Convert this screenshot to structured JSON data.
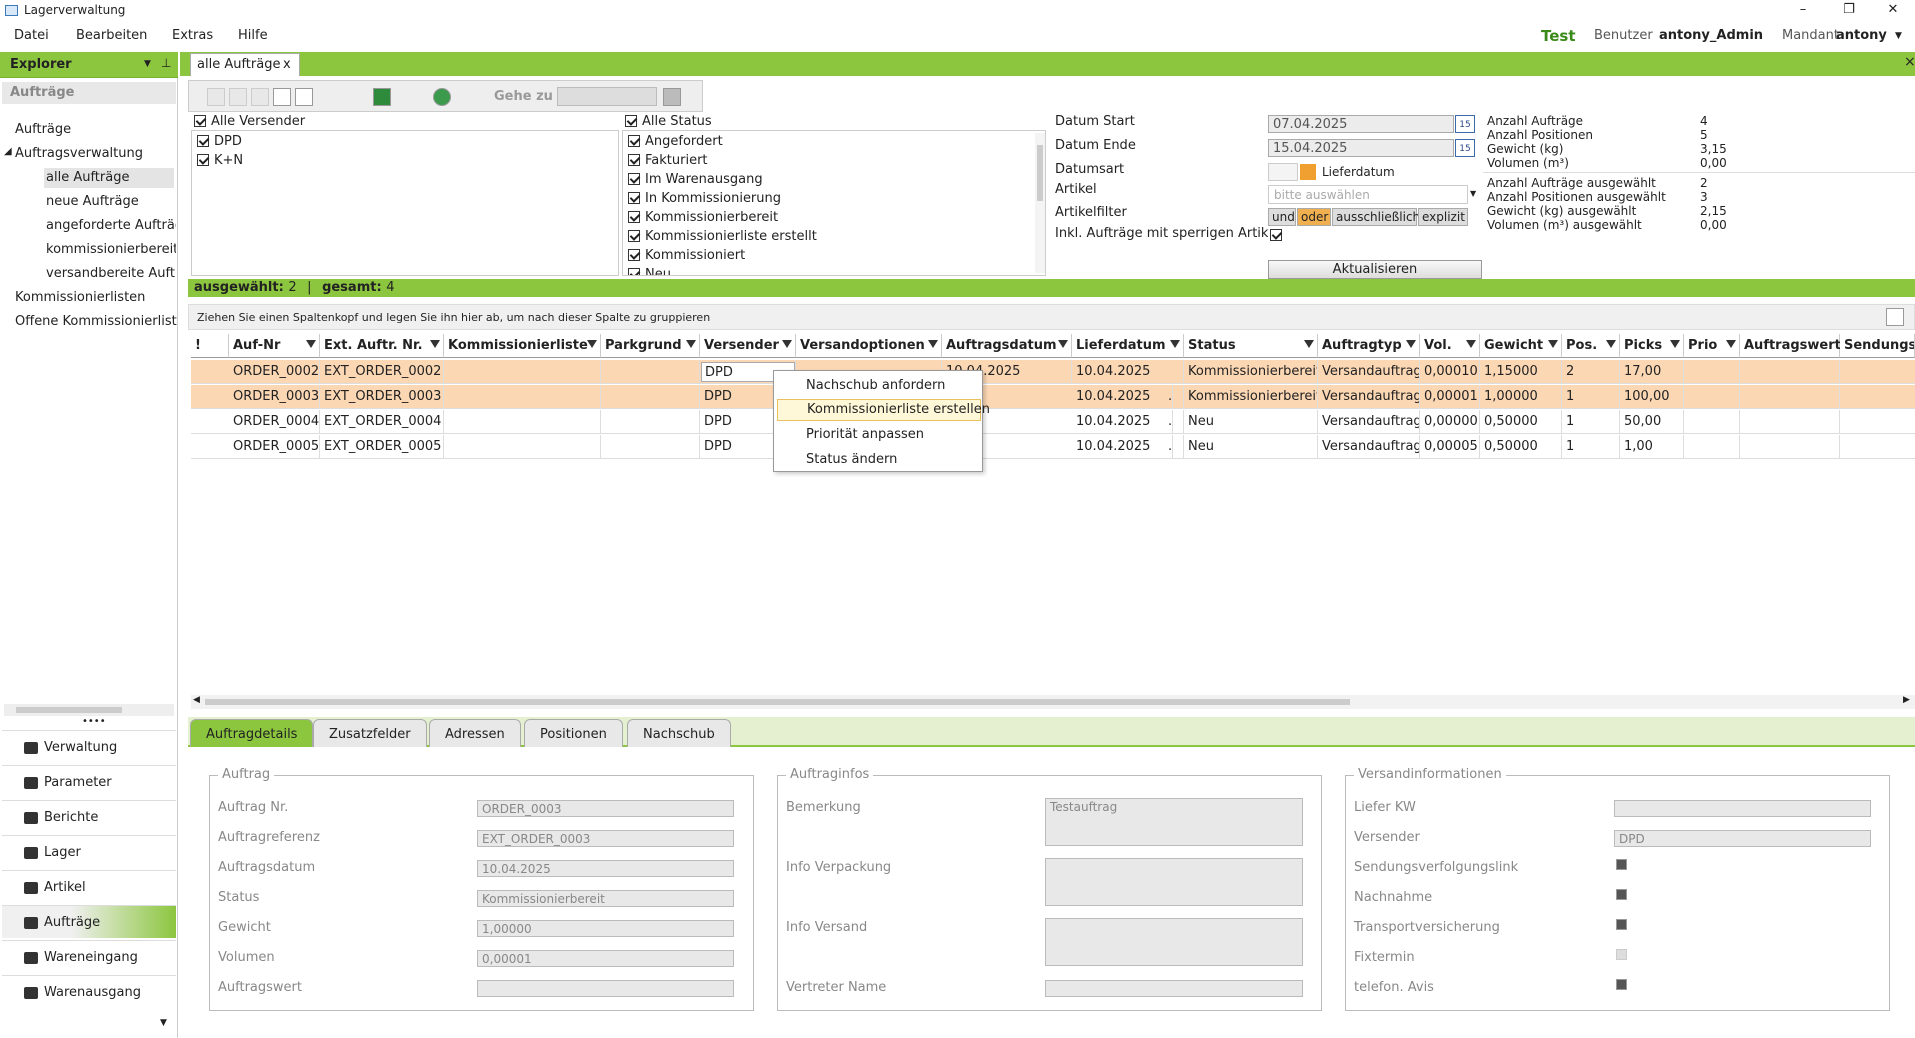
{
  "window": {
    "title": "Lagerverwaltung",
    "min": "–",
    "max": "❐",
    "close": "✕"
  },
  "menu": {
    "items": [
      "Datei",
      "Bearbeiten",
      "Extras",
      "Hilfe"
    ]
  },
  "env": {
    "name": "Test",
    "user_label": "Benutzer",
    "user": "antony_Admin",
    "mandant_label": "Mandant",
    "mandant": "antony"
  },
  "explorer": {
    "title": "Explorer",
    "section": "Aufträge",
    "tree": [
      "Aufträge",
      "Auftragsverwaltung",
      "alle Aufträge",
      "neue Aufträge",
      "angeforderte Aufträge",
      "kommissionierbereite",
      "versandbereite Aufträ",
      "Kommissionierlisten",
      "Offene Kommissionierlister"
    ],
    "nav": [
      "Verwaltung",
      "Parameter",
      "Berichte",
      "Lager",
      "Artikel",
      "Aufträge",
      "Wareneingang",
      "Warenausgang"
    ]
  },
  "tab": {
    "label": "alle Aufträge",
    "close": "x"
  },
  "toolbar": {
    "goto_label": "Gehe zu"
  },
  "filters": {
    "versender_all": "Alle Versender",
    "versender": [
      "DPD",
      "K+N"
    ],
    "status_all": "Alle Status",
    "status": [
      "Angefordert",
      "Fakturiert",
      "Im Warenausgang",
      "In Kommissionierung",
      "Kommissionierbereit",
      "Kommissionierliste erstellt",
      "Kommissioniert",
      "Neu"
    ],
    "datum_start_label": "Datum Start",
    "datum_start": "07.04.2025",
    "datum_ende_label": "Datum Ende",
    "datum_ende": "15.04.2025",
    "cal_label": "15",
    "datumsart_label": "Datumsart",
    "datumsart": "Lieferdatum",
    "artikel_label": "Artikel",
    "artikel_placeholder": "bitte auswählen",
    "artikelfilter_label": "Artikelfilter",
    "artikelfilter": [
      "und",
      "oder",
      "ausschließlich",
      "explizit"
    ],
    "sperrig_label": "Inkl. Aufträge mit sperrigen Artikeln",
    "refresh": "Aktualisieren"
  },
  "stats": [
    {
      "label": "Anzahl Aufträge",
      "value": "4"
    },
    {
      "label": "Anzahl Positionen",
      "value": "5"
    },
    {
      "label": "Gewicht (kg)",
      "value": "3,15"
    },
    {
      "label": "Volumen (m³)",
      "value": "0,00"
    },
    {
      "label": "Anzahl Aufträge ausgewählt",
      "value": "2"
    },
    {
      "label": "Anzahl Positionen ausgewählt",
      "value": "3"
    },
    {
      "label": "Gewicht (kg) ausgewählt",
      "value": "2,15"
    },
    {
      "label": "Volumen (m³) ausgewählt",
      "value": "0,00"
    }
  ],
  "status": {
    "selected_label": "ausgewählt:",
    "selected": "2",
    "sep": "|",
    "total_label": "gesamt:",
    "total": "4"
  },
  "grid": {
    "group_hint": "Ziehen Sie einen Spaltenkopf und legen Sie ihn hier ab, um nach dieser Spalte zu gruppieren",
    "columns": [
      "!",
      "Auf-Nr",
      "Ext. Auftr. Nr.",
      "Kommissionierliste",
      "Parkgrund",
      "Versender",
      "Versandoptionen",
      "Auftragsdatum",
      "Lieferdatum",
      "Status",
      "Auftragtyp",
      "Vol.",
      "Gewicht",
      "Pos.",
      "Picks",
      "Prio",
      "Auftragswert",
      "Sendungsi"
    ],
    "rows": [
      [
        "",
        "ORDER_0002",
        "EXT_ORDER_0002",
        "",
        "",
        "DPD",
        "",
        "10.04.2025",
        "10.04.2025",
        "Kommissionierbereit",
        "Versandauftrag",
        "0,00010",
        "1,15000",
        "2",
        "17,00",
        "",
        "",
        ""
      ],
      [
        "",
        "ORDER_0003",
        "EXT_ORDER_0003",
        "",
        "",
        "DPD",
        "",
        ".2025",
        "10.04.2025",
        "Kommissionierbereit",
        "Versandauftrag",
        "0,00001",
        "1,00000",
        "1",
        "100,00",
        "",
        "",
        ""
      ],
      [
        "",
        "ORDER_0004",
        "EXT_ORDER_0004",
        "",
        "",
        "DPD",
        "",
        ".2025",
        "10.04.2025",
        "Neu",
        "Versandauftrag",
        "0,00000",
        "0,50000",
        "1",
        "50,00",
        "",
        "",
        ""
      ],
      [
        "",
        "ORDER_0005",
        "EXT_ORDER_0005",
        "",
        "",
        "DPD",
        "",
        ".2025",
        "10.04.2025",
        "Neu",
        "Versandauftrag",
        "0,00005",
        "0,50000",
        "1",
        "1,00",
        "",
        "",
        ""
      ]
    ]
  },
  "context_menu": [
    "Nachschub anfordern",
    "Kommissionierliste erstellen",
    "Priorität anpassen",
    "Status ändern"
  ],
  "detail_tabs": [
    "Auftragdetails",
    "Zusatzfelder",
    "Adressen",
    "Positionen",
    "Nachschub"
  ],
  "details": {
    "auftrag": {
      "title": "Auftrag",
      "fields": [
        {
          "label": "Auftrag Nr.",
          "value": "ORDER_0003"
        },
        {
          "label": "Auftragreferenz",
          "value": "EXT_ORDER_0003"
        },
        {
          "label": "Auftragsdatum",
          "value": "10.04.2025"
        },
        {
          "label": "Status",
          "value": "Kommissionierbereit"
        },
        {
          "label": "Gewicht",
          "value": "1,00000"
        },
        {
          "label": "Volumen",
          "value": "0,00001"
        },
        {
          "label": "Auftragswert",
          "value": ""
        }
      ]
    },
    "infos": {
      "title": "Auftraginfos",
      "bemerkung_label": "Bemerkung",
      "bemerkung": "Testauftrag",
      "verpackung_label": "Info Verpackung",
      "versand_label": "Info Versand",
      "vertreter_label": "Vertreter Name"
    },
    "versand": {
      "title": "Versandinformationen",
      "kw_label": "Liefer KW",
      "versender_label": "Versender",
      "versender": "DPD",
      "checks": [
        {
          "label": "Sendungsverfolgungslink",
          "on": true
        },
        {
          "label": "Nachnahme",
          "on": true
        },
        {
          "label": "Transportversicherung",
          "on": true
        },
        {
          "label": "Fixtermin",
          "on": false
        },
        {
          "label": "telefon. Avis",
          "on": true
        }
      ]
    }
  }
}
